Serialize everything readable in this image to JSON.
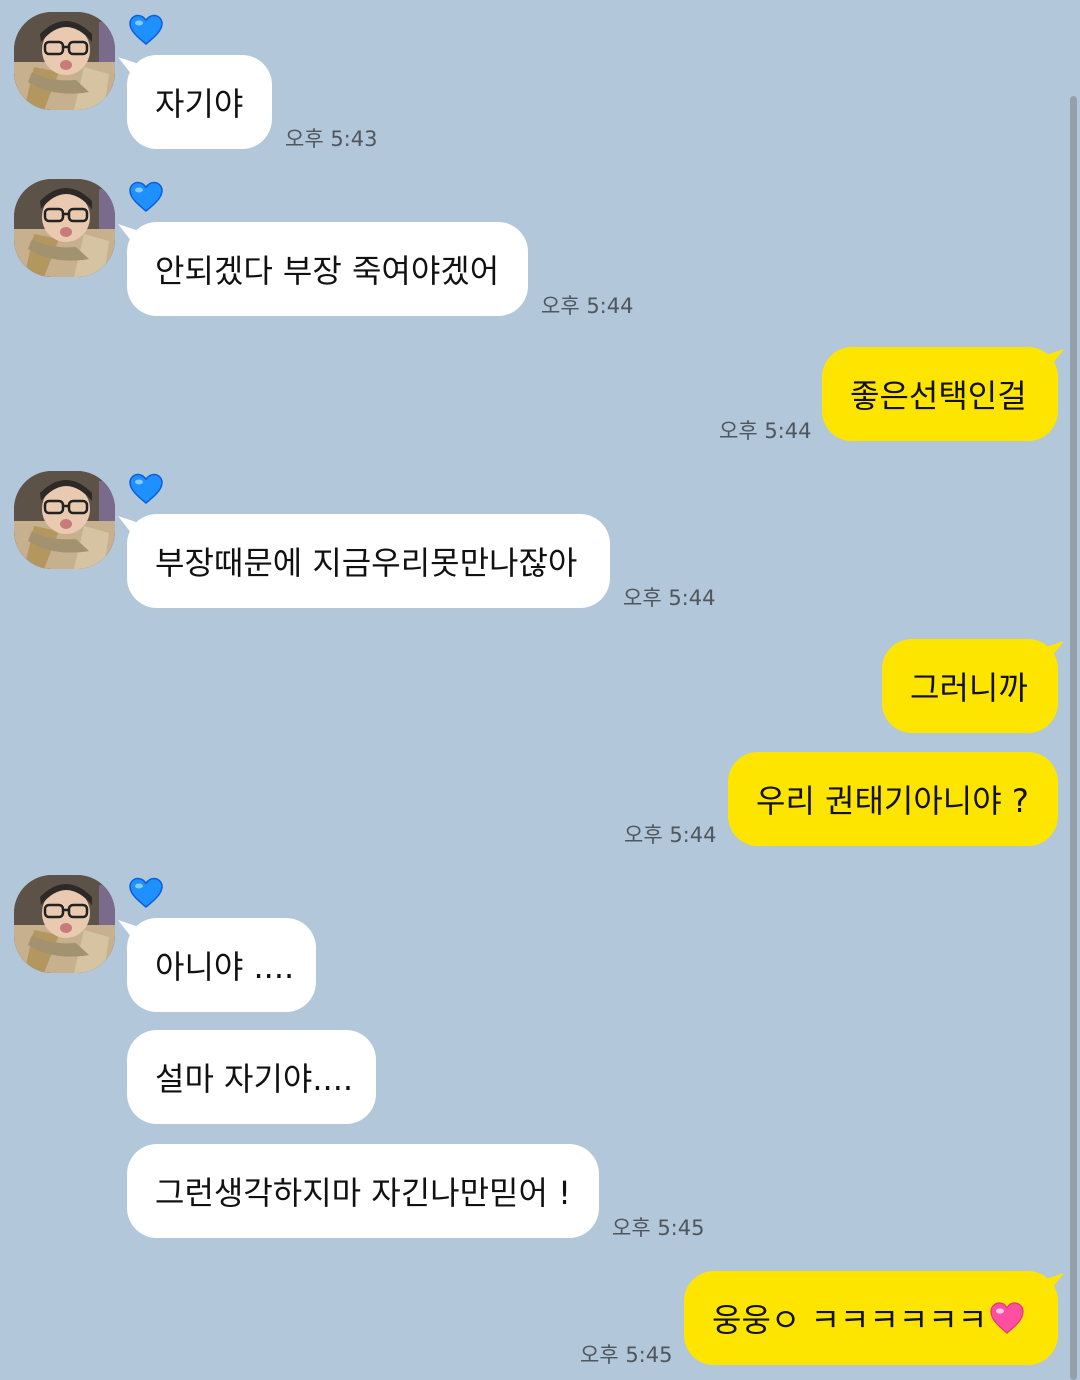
{
  "messages": {
    "m1": {
      "text": "자기야",
      "time": "오후 5:43"
    },
    "m2": {
      "text": "안되겠다 부장 죽여야겠어",
      "time": "오후 5:44"
    },
    "m3": {
      "text": "좋은선택인걸",
      "time": "오후 5:44"
    },
    "m4": {
      "text": "부장때문에 지금우리못만나잖아",
      "time": "오후 5:44"
    },
    "m5": {
      "text": "그러니까"
    },
    "m6": {
      "text": "우리 권태기아니야 ?",
      "time": "오후 5:44"
    },
    "m7": {
      "text": "아니야 ...."
    },
    "m8": {
      "text": "설마 자기야...."
    },
    "m9": {
      "text": "그런생각하지마 자긴나만믿어 !",
      "time": "오후 5:45"
    },
    "m10": {
      "text": "웅웅ㅇ ㅋㅋㅋㅋㅋㅋ",
      "time": "오후 5:45"
    }
  },
  "colors": {
    "background": "#b2c7da",
    "incoming_bubble": "#ffffff",
    "outgoing_bubble": "#fee500",
    "heart_icon": "#1e90ff",
    "pink_heart": "#ff4fa3"
  },
  "icons": {
    "sender_badge": "blue-heart-icon",
    "emoji": "pink-heart-icon"
  }
}
